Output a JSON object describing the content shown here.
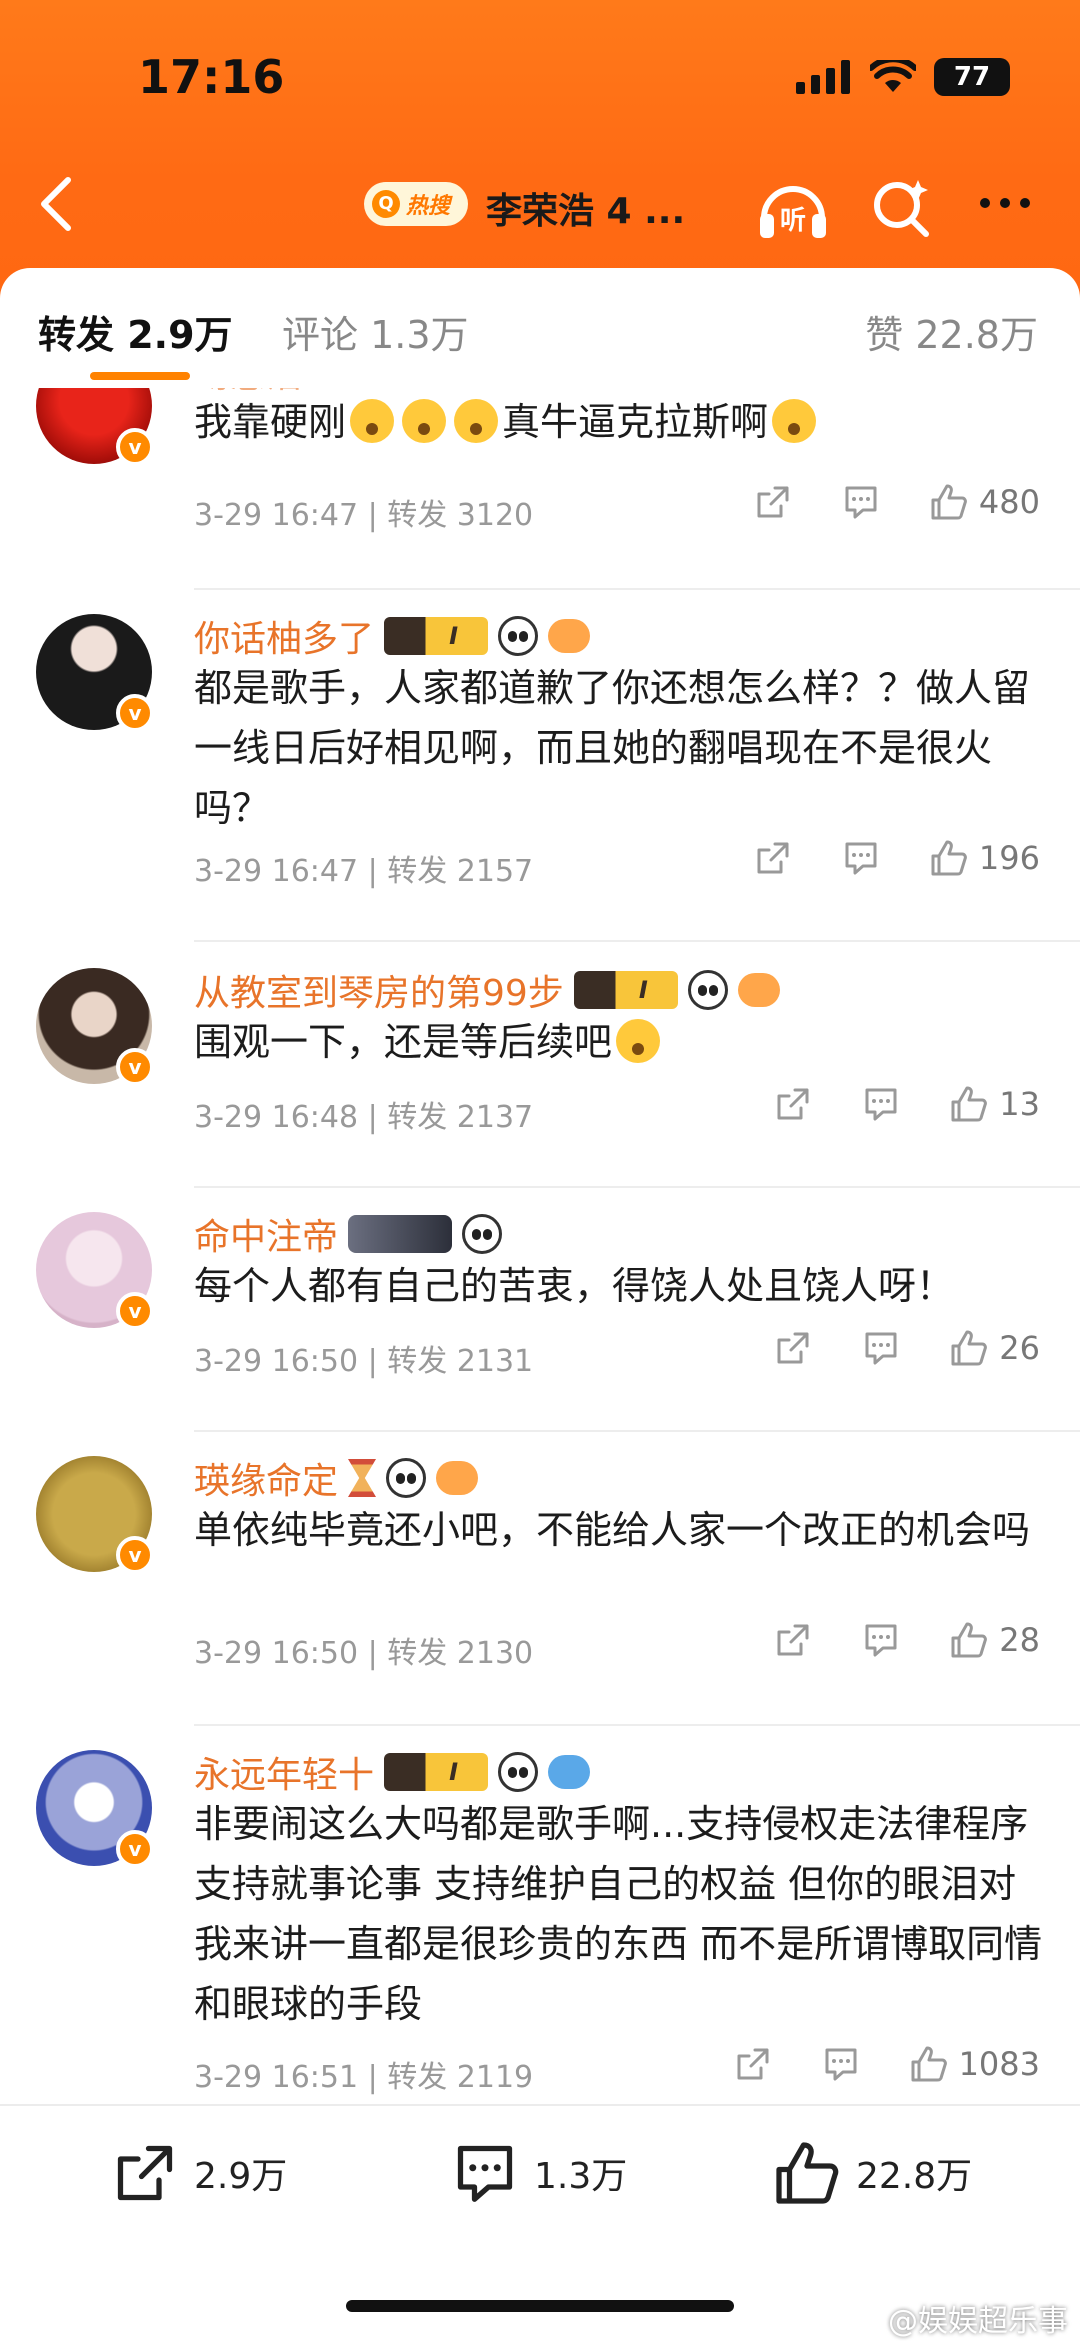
{
  "status_bar": {
    "time": "17:16",
    "battery": "77"
  },
  "nav": {
    "hot_label": "热搜",
    "title": "李荣浩 4 ..."
  },
  "tabs": {
    "repost": "转发 2.9万",
    "comment": "评论 1.3万",
    "like": "赞 22.8万"
  },
  "comments": [
    {
      "username": "吻感浩",
      "text": "我靠硬刚",
      "text_tail": "真牛逼克拉斯啊",
      "time": "3-29 16:47",
      "reposts": "转发 3120",
      "likes": "480"
    },
    {
      "username": "你话柚多了",
      "text": "都是歌手，人家都道歉了你还想怎么样？？做人留一线日后好相见啊，而且她的翻唱现在不是很火吗？",
      "time": "3-29 16:47",
      "reposts": "转发 2157",
      "likes": "196"
    },
    {
      "username": "从教室到琴房的第99步",
      "text": "围观一下，还是等后续吧",
      "time": "3-29 16:48",
      "reposts": "转发 2137",
      "likes": "13"
    },
    {
      "username": "命中注帝",
      "text": "每个人都有自己的苦衷，得饶人处且饶人呀！",
      "time": "3-29 16:50",
      "reposts": "转发 2131",
      "likes": "26"
    },
    {
      "username": "瑛缘命定",
      "text": "单依纯毕竟还小吧，不能给人家一个改正的机会吗",
      "time": "3-29 16:50",
      "reposts": "转发 2130",
      "likes": "28"
    },
    {
      "username": "永远年轻十",
      "text": "非要闹这么大吗都是歌手啊...支持侵权走法律程序 支持就事论事 支持维护自己的权益 但你的眼泪对我来讲一直都是很珍贵的东西 而不是所谓博取同情和眼球的手段",
      "time": "3-29 16:51",
      "reposts": "转发 2119",
      "likes": "1083"
    }
  ],
  "bottom_bar": {
    "repost": "2.9万",
    "comment": "1.3万",
    "like": "22.8万"
  },
  "watermark": "@娱娱超乐事",
  "colors": {
    "accent": "#ff8200",
    "username": "#e8742a",
    "header_orange": "#ff6f16"
  }
}
